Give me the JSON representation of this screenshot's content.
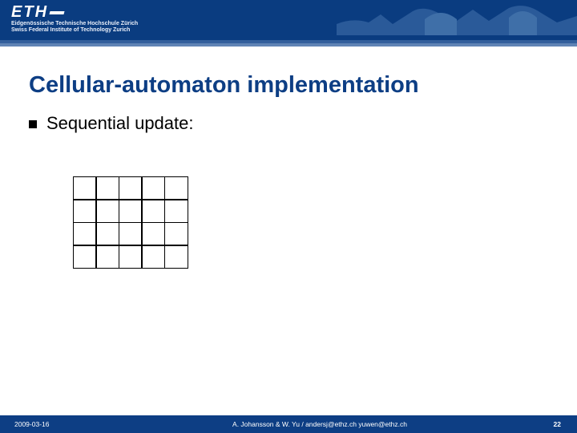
{
  "institution": {
    "logo_letters": "ETH",
    "sub_line1": "Eidgenössische Technische Hochschule Zürich",
    "sub_line2": "Swiss Federal Institute of Technology Zurich"
  },
  "slide": {
    "title": "Cellular-automaton implementation",
    "bullet1": "Sequential update:"
  },
  "grid": {
    "rows": 4,
    "cols": 5
  },
  "footer": {
    "date": "2009-03-16",
    "authors": "A. Johansson & W. Yu / andersj@ethz.ch yuwen@ethz.ch",
    "page": "22"
  }
}
